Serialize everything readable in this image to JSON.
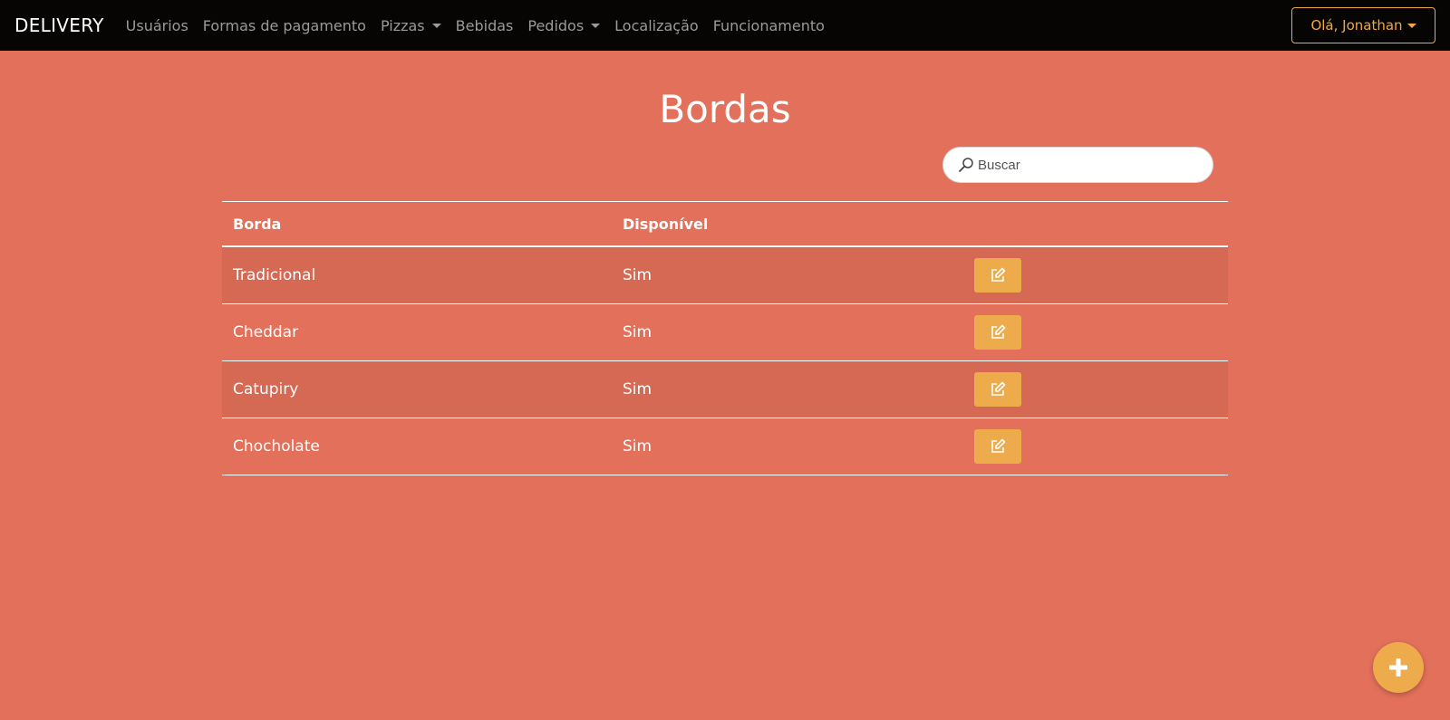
{
  "colors": {
    "background": "#e2705a",
    "navbar": "#060504",
    "accent": "#f0a93f",
    "button": "#eeab4c",
    "row_striped": "#d56953"
  },
  "navbar": {
    "brand": "DELIVERY",
    "items": [
      {
        "label": "Usuários",
        "dropdown": false
      },
      {
        "label": "Formas de pagamento",
        "dropdown": false
      },
      {
        "label": "Pizzas",
        "dropdown": true
      },
      {
        "label": "Bebidas",
        "dropdown": false
      },
      {
        "label": "Pedidos",
        "dropdown": true
      },
      {
        "label": "Localização",
        "dropdown": false
      },
      {
        "label": "Funcionamento",
        "dropdown": false
      }
    ],
    "user_label": "Olá, Jonathan"
  },
  "main": {
    "title": "Bordas",
    "search": {
      "placeholder": "Buscar",
      "value": "",
      "icon": "search-icon"
    },
    "table": {
      "headers": [
        "Borda",
        "Disponível",
        ""
      ],
      "rows": [
        {
          "borda": "Tradicional",
          "disponivel": "Sim",
          "action_icon": "edit-icon"
        },
        {
          "borda": "Cheddar",
          "disponivel": "Sim",
          "action_icon": "edit-icon"
        },
        {
          "borda": "Catupiry",
          "disponivel": "Sim",
          "action_icon": "edit-icon"
        },
        {
          "borda": "Chocholate",
          "disponivel": "Sim",
          "action_icon": "edit-icon"
        }
      ]
    }
  },
  "fab": {
    "icon": "plus-icon"
  }
}
